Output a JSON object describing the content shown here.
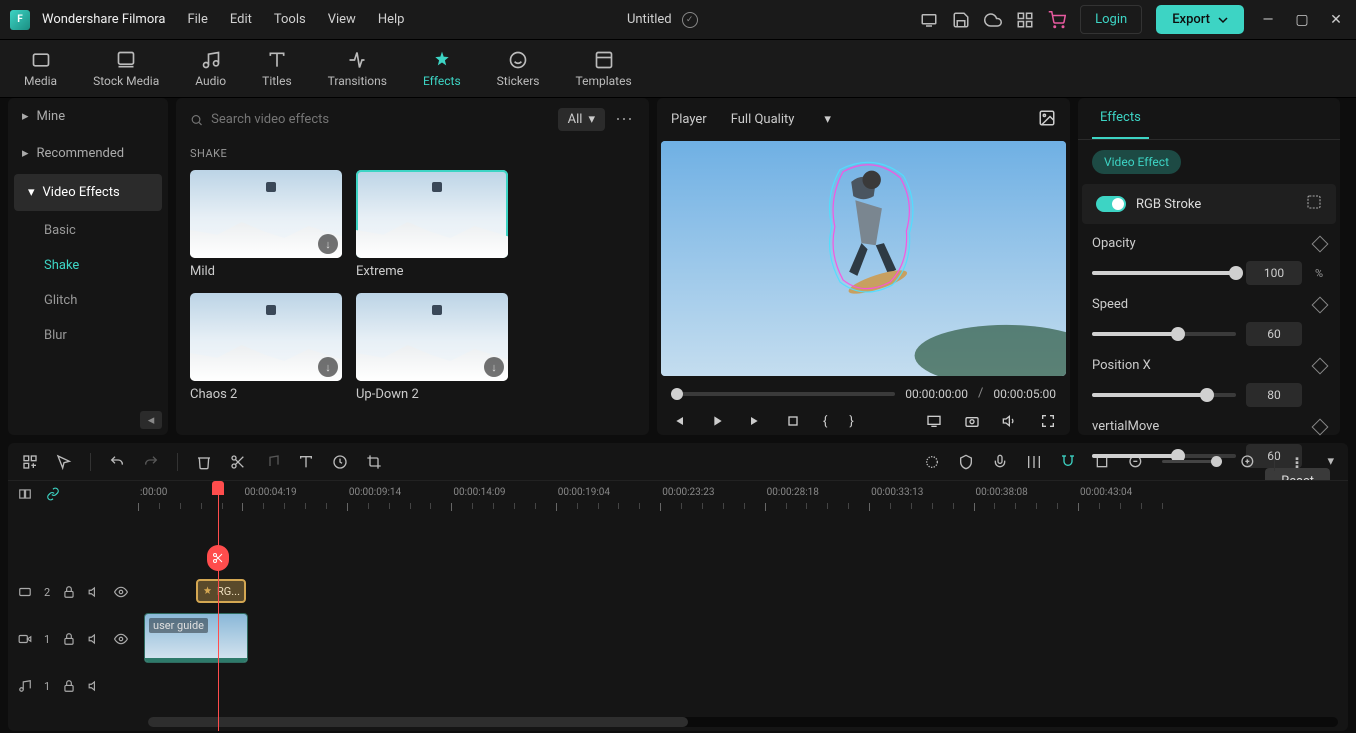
{
  "app_name": "Wondershare Filmora",
  "menu": [
    "File",
    "Edit",
    "Tools",
    "View",
    "Help"
  ],
  "doc_title": "Untitled",
  "login": "Login",
  "export": "Export",
  "tabs": [
    {
      "label": "Media"
    },
    {
      "label": "Stock Media"
    },
    {
      "label": "Audio"
    },
    {
      "label": "Titles"
    },
    {
      "label": "Transitions"
    },
    {
      "label": "Effects"
    },
    {
      "label": "Stickers"
    },
    {
      "label": "Templates"
    }
  ],
  "side": {
    "mine": "Mine",
    "recommended": "Recommended",
    "video_effects": "Video Effects",
    "subs": [
      "Basic",
      "Shake",
      "Glitch",
      "Blur"
    ]
  },
  "browser": {
    "search_placeholder": "Search video effects",
    "filter": "All",
    "section": "SHAKE",
    "items": [
      {
        "label": "Mild",
        "selected": false,
        "dl": true
      },
      {
        "label": "Extreme",
        "selected": true,
        "dl": false
      },
      {
        "label": "Chaos 2",
        "selected": false,
        "dl": true
      },
      {
        "label": "Up-Down 2",
        "selected": false,
        "dl": true
      }
    ]
  },
  "player": {
    "label": "Player",
    "quality": "Full Quality",
    "t_current": "00:00:00:00",
    "t_total": "00:00:05:00",
    "sep": "/"
  },
  "props": {
    "tab": "Effects",
    "chip": "Video Effect",
    "name": "RGB Stroke",
    "params": [
      {
        "label": "Opacity",
        "value": "100",
        "pct": "%",
        "fill": 100
      },
      {
        "label": "Speed",
        "value": "60",
        "pct": "",
        "fill": 60
      },
      {
        "label": "Position X",
        "value": "80",
        "pct": "",
        "fill": 80
      },
      {
        "label": "vertialMove",
        "value": "60",
        "pct": "",
        "fill": 60
      }
    ],
    "reset": "Reset"
  },
  "timeline": {
    "ruler": [
      ":00:00",
      "00:00:04:19",
      "00:00:09:14",
      "00:00:14:09",
      "00:00:19:04",
      "00:00:23:23",
      "00:00:28:18",
      "00:00:33:13",
      "00:00:38:08",
      "00:00:43:04"
    ],
    "playhead_pct": 8.5,
    "tracks": [
      {
        "icon": "fx",
        "num": "2"
      },
      {
        "icon": "vid",
        "num": "1"
      },
      {
        "icon": "aud",
        "num": "1"
      }
    ],
    "effect_clip": "RG...",
    "video_clip": "user guide"
  }
}
